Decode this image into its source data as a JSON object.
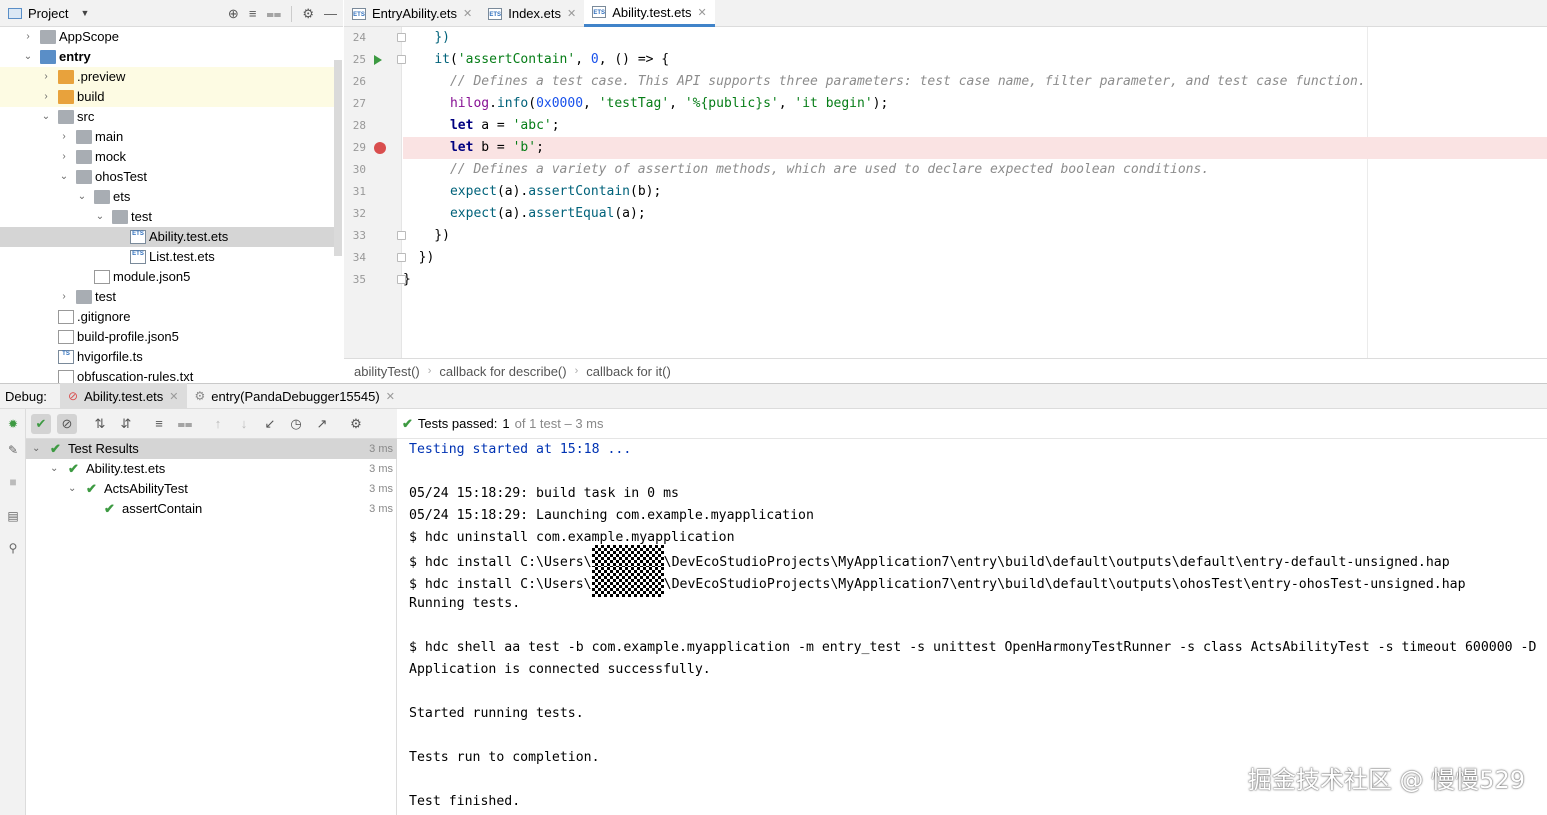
{
  "project": {
    "title": "Project",
    "tree": [
      {
        "label": "AppScope",
        "type": "folder",
        "depth": 1,
        "expanded": false
      },
      {
        "label": "entry",
        "type": "folder-b",
        "depth": 1,
        "expanded": true,
        "bold": true
      },
      {
        "label": ".preview",
        "type": "folder-o",
        "depth": 2,
        "expanded": false
      },
      {
        "label": "build",
        "type": "folder-o",
        "depth": 2,
        "expanded": false
      },
      {
        "label": "src",
        "type": "folder",
        "depth": 2,
        "expanded": true
      },
      {
        "label": "main",
        "type": "folder",
        "depth": 3,
        "expanded": false
      },
      {
        "label": "mock",
        "type": "folder",
        "depth": 3,
        "expanded": false
      },
      {
        "label": "ohosTest",
        "type": "folder",
        "depth": 3,
        "expanded": true
      },
      {
        "label": "ets",
        "type": "folder",
        "depth": 4,
        "expanded": true
      },
      {
        "label": "test",
        "type": "folder",
        "depth": 5,
        "expanded": true
      },
      {
        "label": "Ability.test.ets",
        "type": "ets",
        "depth": 6,
        "selected": true
      },
      {
        "label": "List.test.ets",
        "type": "ets",
        "depth": 6
      },
      {
        "label": "module.json5",
        "type": "gen",
        "depth": 4
      },
      {
        "label": "test",
        "type": "folder",
        "depth": 3,
        "expanded": false
      },
      {
        "label": ".gitignore",
        "type": "gen",
        "depth": 2
      },
      {
        "label": "build-profile.json5",
        "type": "gen",
        "depth": 2
      },
      {
        "label": "hvigorfile.ts",
        "type": "ts",
        "depth": 2
      },
      {
        "label": "obfuscation-rules.txt",
        "type": "gen",
        "depth": 2
      }
    ]
  },
  "editor": {
    "tabs": [
      {
        "label": "EntryAbility.ets",
        "active": false
      },
      {
        "label": "Index.ets",
        "active": false
      },
      {
        "label": "Ability.test.ets",
        "active": true
      }
    ],
    "line_numbers": [
      "24",
      "25",
      "26",
      "27",
      "28",
      "29",
      "30",
      "31",
      "32",
      "33",
      "34",
      "35"
    ],
    "breadcrumbs": [
      "abilityTest()",
      "callback for describe()",
      "callback for it()"
    ]
  },
  "debug": {
    "label": "Debug:",
    "tabs": [
      {
        "label": "Ability.test.ets",
        "active": true
      },
      {
        "label": "entry(PandaDebugger15545)",
        "active": false
      }
    ],
    "status": {
      "prefix": "Tests passed:",
      "count": "1",
      "suffix": "of 1 test – 3 ms"
    },
    "results": [
      {
        "label": "Test Results",
        "depth": 0,
        "time": "3 ms",
        "selected": true
      },
      {
        "label": "Ability.test.ets",
        "depth": 1,
        "time": "3 ms"
      },
      {
        "label": "ActsAbilityTest",
        "depth": 2,
        "time": "3 ms"
      },
      {
        "label": "assertContain",
        "depth": 3,
        "time": "3 ms"
      }
    ],
    "console": [
      {
        "text": "Testing started at 15:18 ...",
        "blue": true
      },
      {
        "text": ""
      },
      {
        "text": "05/24 15:18:29: build task in 0 ms"
      },
      {
        "text": "05/24 15:18:29: Launching com.example.myapplication"
      },
      {
        "text": "$ hdc uninstall com.example.myapplication"
      },
      {
        "text": "$ hdc install C:\\Users\\",
        "mask": true,
        "tail": "\\DevEcoStudioProjects\\MyApplication7\\entry\\build\\default\\outputs\\default\\entry-default-unsigned.hap"
      },
      {
        "text": "$ hdc install C:\\Users\\",
        "mask": true,
        "tail": "\\DevEcoStudioProjects\\MyApplication7\\entry\\build\\default\\outputs\\ohosTest\\entry-ohosTest-unsigned.hap"
      },
      {
        "text": "Running tests."
      },
      {
        "text": ""
      },
      {
        "text": "$ hdc shell aa test -b com.example.myapplication -m entry_test -s unittest OpenHarmonyTestRunner -s class ActsAbilityTest -s timeout 600000 -D"
      },
      {
        "text": "Application is connected successfully."
      },
      {
        "text": ""
      },
      {
        "text": "Started running tests."
      },
      {
        "text": ""
      },
      {
        "text": "Tests run to completion."
      },
      {
        "text": ""
      },
      {
        "text": "Test finished."
      }
    ]
  },
  "watermark": "掘金技术社区 @ 慢慢529"
}
